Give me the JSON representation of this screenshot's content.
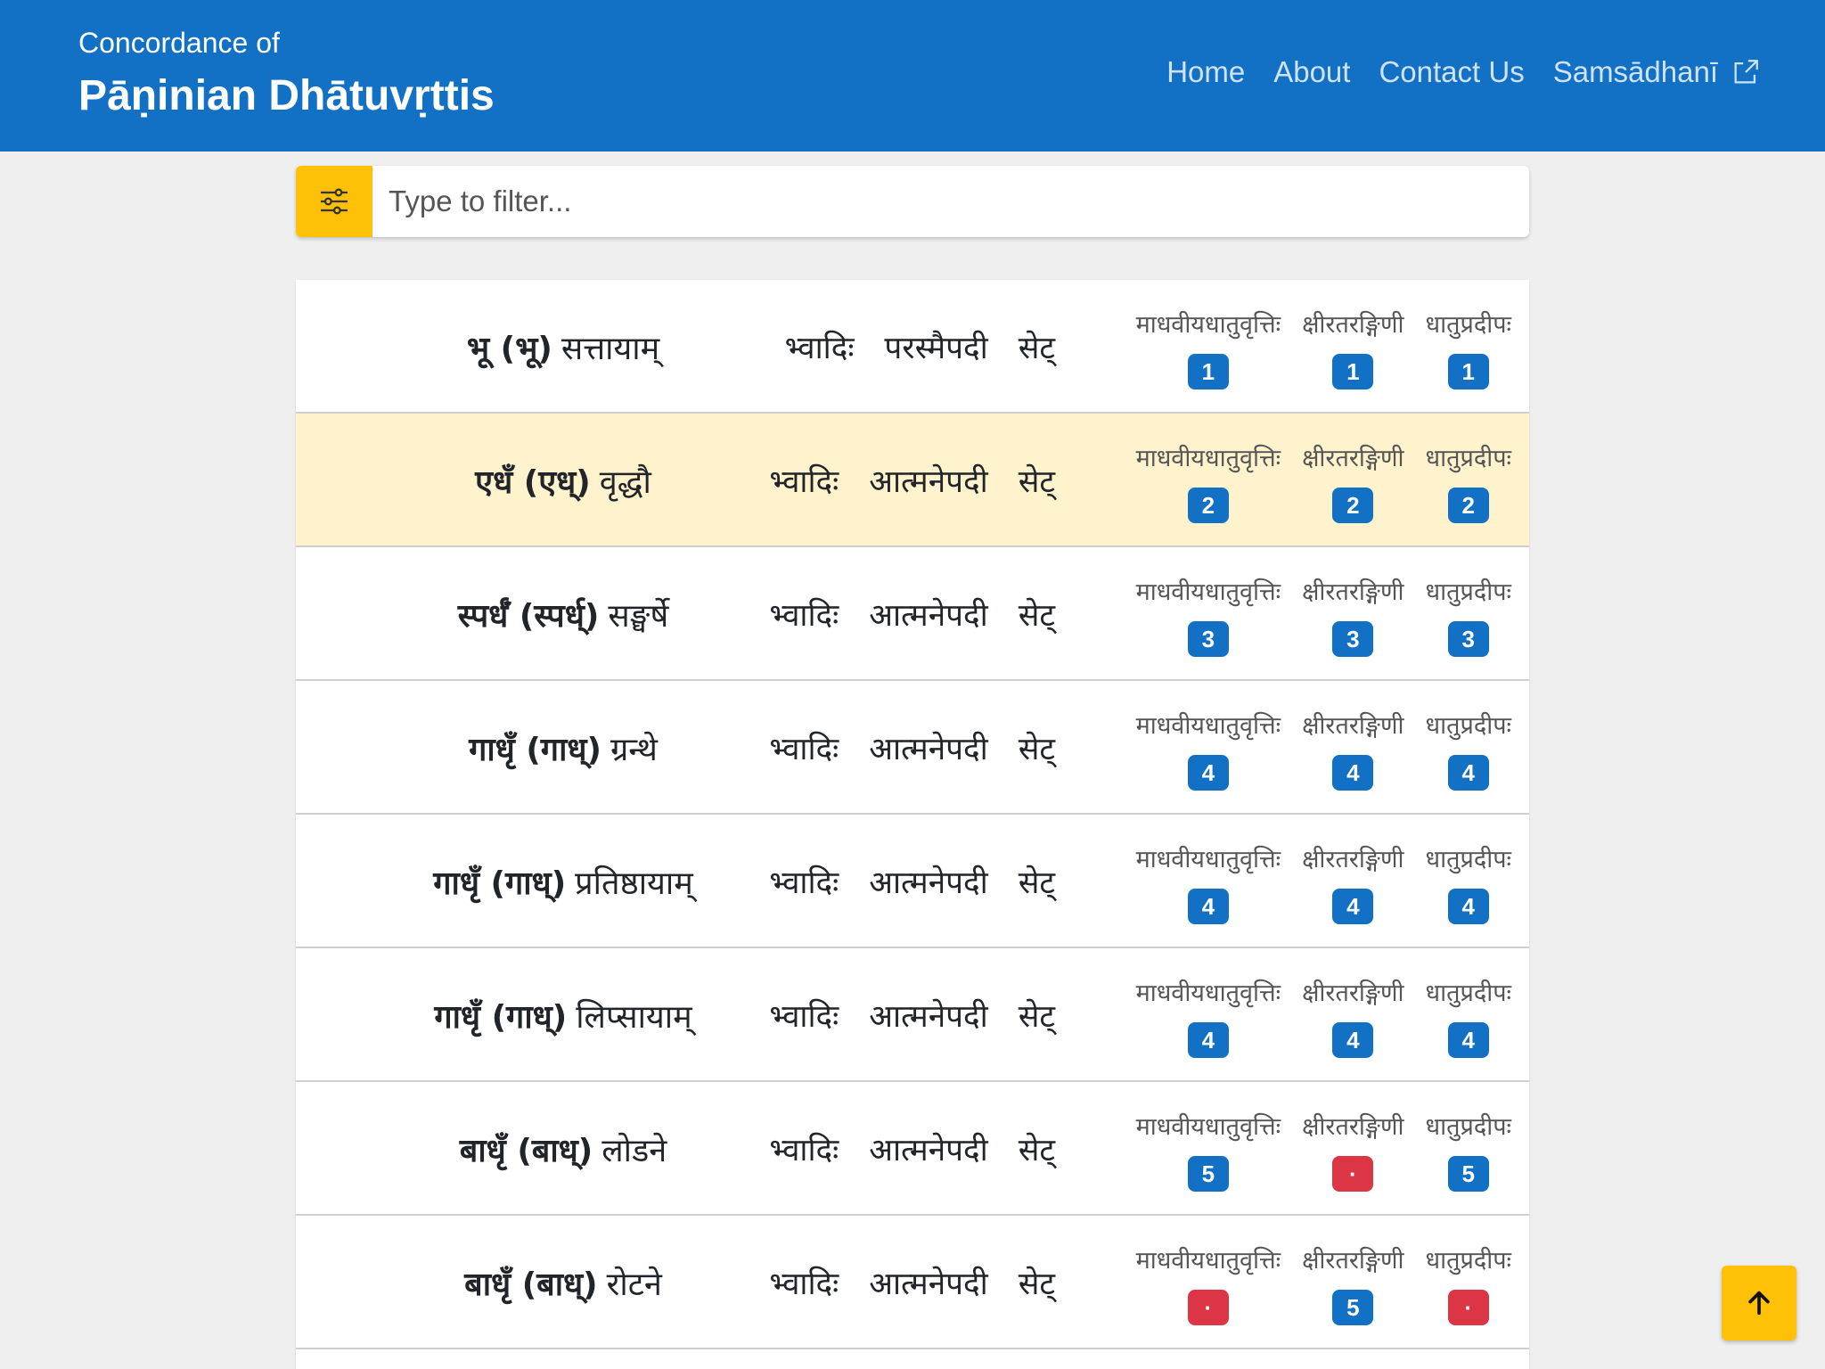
{
  "header": {
    "subtitle": "Concordance of",
    "title": "Pāṇinian Dhātuvṛttis",
    "nav": [
      "Home",
      "About",
      "Contact Us",
      "Samsādhanī"
    ]
  },
  "filter": {
    "placeholder": "Type to filter..."
  },
  "rows": [
    {
      "root": "भू (भू)",
      "meaning": "सत्तायाम्",
      "gana": "भ्वादिः",
      "pada": "परस्मैपदी",
      "it": "सेट्",
      "refs": [
        "1",
        "1",
        "1"
      ]
    },
    {
      "root": "एधँ (एध्)",
      "meaning": "वृद्धौ",
      "gana": "भ्वादिः",
      "pada": "आत्मनेपदी",
      "it": "सेट्",
      "refs": [
        "2",
        "2",
        "2"
      ]
    },
    {
      "root": "स्पर्धँ (स्पर्ध्)",
      "meaning": "सङ्घर्षे",
      "gana": "भ्वादिः",
      "pada": "आत्मनेपदी",
      "it": "सेट्",
      "refs": [
        "3",
        "3",
        "3"
      ]
    },
    {
      "root": "गाधृँ (गाध्)",
      "meaning": "ग्रन्थे",
      "gana": "भ्वादिः",
      "pada": "आत्मनेपदी",
      "it": "सेट्",
      "refs": [
        "4",
        "4",
        "4"
      ]
    },
    {
      "root": "गाधृँ (गाध्)",
      "meaning": "प्रतिष्ठायाम्",
      "gana": "भ्वादिः",
      "pada": "आत्मनेपदी",
      "it": "सेट्",
      "refs": [
        "4",
        "4",
        "4"
      ]
    },
    {
      "root": "गाधृँ (गाध्)",
      "meaning": "लिप्सायाम्",
      "gana": "भ्वादिः",
      "pada": "आत्मनेपदी",
      "it": "सेट्",
      "refs": [
        "4",
        "4",
        "4"
      ]
    },
    {
      "root": "बाधृँ (बाध्)",
      "meaning": "लोडने",
      "gana": "भ्वादिः",
      "pada": "आत्मनेपदी",
      "it": "सेट्",
      "refs": [
        "5",
        "·",
        "5"
      ]
    },
    {
      "root": "बाधृँ (बाध्)",
      "meaning": "रोटने",
      "gana": "भ्वादिः",
      "pada": "आत्मनेपदी",
      "it": "सेट्",
      "refs": [
        "·",
        "5",
        "·"
      ]
    }
  ],
  "ref_labels": [
    "माधवीयधातुवृत्तिः",
    "क्षीरतरङ्गिणी",
    "धातुप्रदीपः"
  ],
  "colors": {
    "navbar": "#1271c4",
    "accent": "#ffc107",
    "badge": "#1271c4",
    "missing": "#dc3545",
    "highlight": "#fff3cd"
  }
}
